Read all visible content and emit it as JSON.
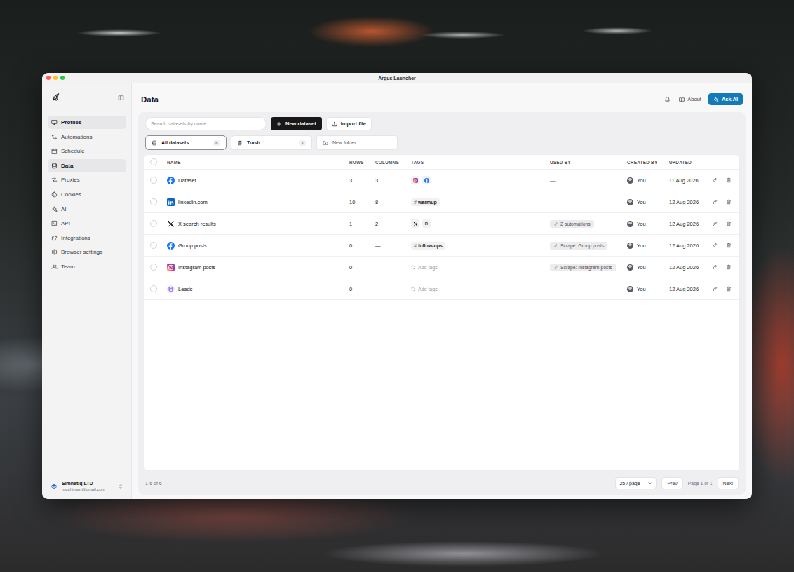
{
  "window": {
    "title": "Argus Launcher"
  },
  "sidebar": {
    "items": [
      {
        "label": "Profiles",
        "selected": true
      },
      {
        "label": "Automations",
        "selected": false
      },
      {
        "label": "Schedule",
        "selected": false
      },
      {
        "label": "Data",
        "selected": true
      },
      {
        "label": "Proxies",
        "selected": false
      },
      {
        "label": "Cookies",
        "selected": false
      },
      {
        "label": "AI",
        "selected": false
      },
      {
        "label": "API",
        "selected": false
      },
      {
        "label": "Integrations",
        "selected": false
      },
      {
        "label": "Browser settings",
        "selected": false
      },
      {
        "label": "Team",
        "selected": false
      }
    ],
    "account": {
      "name": "Simnetiq LTD",
      "email": "rpochtman@gmail.com"
    }
  },
  "header": {
    "title": "Data",
    "about": "About",
    "ask_ai": "Ask AI"
  },
  "toolbar": {
    "search": {
      "placeholder": "Search datasets by name"
    },
    "new_button": "New dataset",
    "import_button": "Import file"
  },
  "folders": [
    {
      "kind": "all",
      "label": "All datasets",
      "count": "6",
      "selected": true
    },
    {
      "kind": "trash",
      "label": "Trash",
      "count": "3",
      "selected": false
    },
    {
      "kind": "new",
      "label": "New folder",
      "selected": false
    }
  ],
  "table": {
    "all_selected": false,
    "columns": [
      "NAME",
      "ROWS",
      "COLUMNS",
      "TAGS",
      "USED BY",
      "CREATED BY",
      "UPDATED"
    ],
    "rows": [
      {
        "name": "Dataset",
        "kind": "facebook",
        "rows": "3",
        "columns": "3",
        "tags": [
          {
            "kind": "instagram"
          },
          {
            "kind": "facebook"
          }
        ],
        "used_by": {
          "kind": "none",
          "label": "—"
        },
        "created_by": "You",
        "updated": "11 Aug 2026",
        "selected": false
      },
      {
        "name": "linkedin.com",
        "kind": "linkedin",
        "rows": "10",
        "columns": "8",
        "tags": [
          {
            "kind": "hash",
            "symbol": "#",
            "label": "warmup"
          }
        ],
        "used_by": {
          "kind": "none",
          "label": "—"
        },
        "created_by": "You",
        "updated": "12 Aug 2026",
        "selected": false
      },
      {
        "name": "X search results",
        "kind": "x",
        "rows": "1",
        "columns": "2",
        "tags": [
          {
            "kind": "x"
          },
          {
            "kind": "letter",
            "label": "R"
          }
        ],
        "used_by": {
          "kind": "pill",
          "label": "2 automations"
        },
        "created_by": "You",
        "updated": "12 Aug 2026",
        "selected": false
      },
      {
        "name": "Group posts",
        "kind": "facebook",
        "rows": "0",
        "columns": "—",
        "tags": [
          {
            "kind": "hash",
            "symbol": "#",
            "label": "follow-ups"
          }
        ],
        "used_by": {
          "kind": "pill",
          "label": "Scrape: Group posts"
        },
        "created_by": "You",
        "updated": "12 Aug 2026",
        "selected": false
      },
      {
        "name": "Instagram posts",
        "kind": "instagram",
        "rows": "0",
        "columns": "—",
        "tags": [
          {
            "kind": "add",
            "label": "Add tags"
          }
        ],
        "used_by": {
          "kind": "pill",
          "label": "Scrape: Instagram posts"
        },
        "created_by": "You",
        "updated": "12 Aug 2026",
        "selected": false
      },
      {
        "name": "Leads",
        "kind": "dataset",
        "rows": "0",
        "columns": "—",
        "tags": [
          {
            "kind": "add",
            "label": "Add tags"
          }
        ],
        "used_by": {
          "kind": "none",
          "label": "—"
        },
        "created_by": "You",
        "updated": "12 Aug 2026",
        "selected": false
      }
    ]
  },
  "footer": {
    "range": "1-6 of 6",
    "per_page": "25 / page",
    "prev": "Prev",
    "page": "Page 1 of 1",
    "next": "Next"
  }
}
